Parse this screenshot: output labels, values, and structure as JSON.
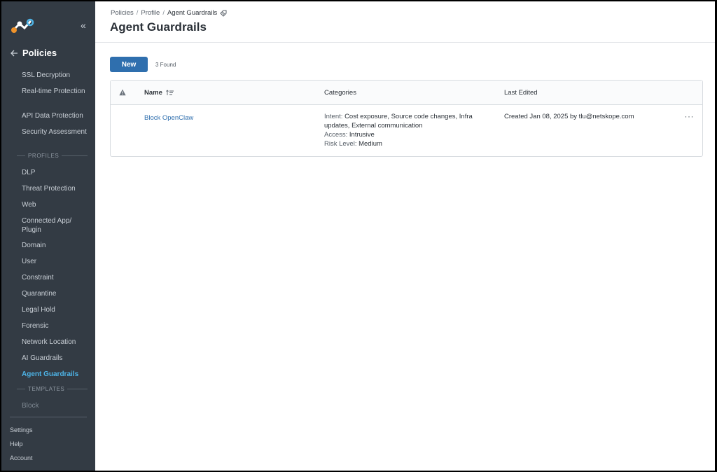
{
  "sidebar": {
    "back_title": "Policies",
    "items": [
      {
        "label": "SSL Decryption"
      },
      {
        "label": "Real-time Protection"
      },
      {
        "label": "API Data Protection"
      },
      {
        "label": "Security Assessment"
      }
    ],
    "profiles_heading": "PROFILES",
    "profiles": [
      {
        "label": "DLP"
      },
      {
        "label": "Threat Protection"
      },
      {
        "label": "Web"
      },
      {
        "label": "Connected App/ Plugin"
      },
      {
        "label": "Domain"
      },
      {
        "label": "User"
      },
      {
        "label": "Constraint"
      },
      {
        "label": "Quarantine"
      },
      {
        "label": "Legal Hold"
      },
      {
        "label": "Forensic"
      },
      {
        "label": "Network Location"
      },
      {
        "label": "AI Guardrails"
      },
      {
        "label": "Agent Guardrails",
        "active": true
      }
    ],
    "templates_heading": "TEMPLATES",
    "templates": [
      {
        "label": "Block"
      }
    ],
    "footer": [
      {
        "label": "Settings"
      },
      {
        "label": "Help"
      },
      {
        "label": "Account"
      }
    ]
  },
  "header": {
    "breadcrumb": [
      "Policies",
      "Profile",
      "Agent Guardrails"
    ],
    "title": "Agent Guardrails"
  },
  "toolbar": {
    "new_label": "New",
    "found_text": "3 Found"
  },
  "table": {
    "columns": [
      "Name",
      "Categories",
      "Last Edited"
    ],
    "rows": [
      {
        "name": "Block OpenClaw",
        "intent_label": "Intent:",
        "intent_value": "Cost exposure, Source code changes, Infra updates, External communication",
        "access_label": "Access:",
        "access_value": "Intrusive",
        "risk_label": "Risk Level:",
        "risk_value": "Medium",
        "last_edited": "Created Jan 08, 2025 by tlu@netskope.com",
        "more": "···"
      }
    ]
  },
  "colors": {
    "sidebar_bg": "#333b44",
    "accent": "#2f6fae",
    "active_nav": "#4db3e6",
    "logo_orange": "#f0932b",
    "logo_blue": "#4db3e6"
  }
}
